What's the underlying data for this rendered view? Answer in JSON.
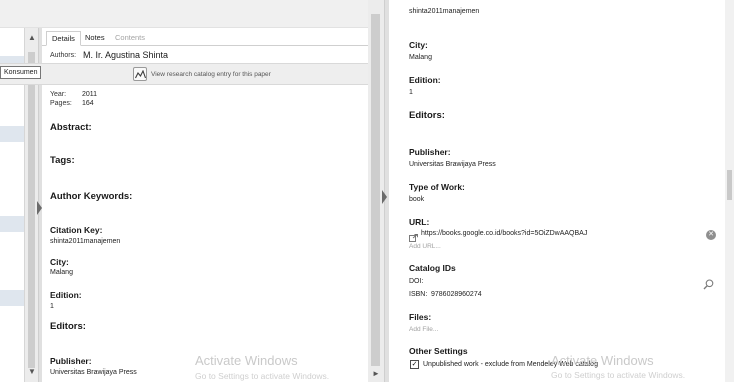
{
  "left": {
    "tabs": [
      {
        "label": "Details",
        "active": true
      },
      {
        "label": "Notes",
        "active": false
      },
      {
        "label": "Contents",
        "active": false
      }
    ],
    "authors_label": "Authors:",
    "authors_value": "M. Ir. Agustina Shinta",
    "tooltip": "Konsumen",
    "catalog_link": "View research catalog entry for this paper",
    "year_label": "Year:",
    "year_value": "2011",
    "pages_label": "Pages:",
    "pages_value": "164",
    "abstract_label": "Abstract:",
    "tags_label": "Tags:",
    "author_keywords_label": "Author Keywords:",
    "citation_key_label": "Citation Key:",
    "citation_key_value": "shinta2011manajemen",
    "city_label": "City:",
    "city_value": "Malang",
    "edition_label": "Edition:",
    "edition_value": "1",
    "editors_label": "Editors:",
    "publisher_label": "Publisher:",
    "publisher_value": "Universitas Brawijaya Press",
    "watermark_title": "Activate Windows",
    "watermark_sub": "Go to Settings to activate Windows."
  },
  "right": {
    "top_value": "shinta2011manajemen",
    "city_label": "City:",
    "city_value": "Malang",
    "edition_label": "Edition:",
    "edition_value": "1",
    "editors_label": "Editors:",
    "publisher_label": "Publisher:",
    "publisher_value": "Universitas Brawijaya Press",
    "type_label": "Type of Work:",
    "type_value": "book",
    "url_label": "URL:",
    "url_value": "https://books.google.co.id/books?id=5OiZDwAAQBAJ",
    "add_url": "Add URL...",
    "catalog_ids_label": "Catalog IDs",
    "doi_label": "DOI:",
    "isbn_label": "ISBN:",
    "isbn_value": "9786028960274",
    "files_label": "Files:",
    "add_file": "Add File...",
    "other_settings_label": "Other Settings",
    "unpublished_label": "Unpublished work - exclude from Mendeley Web catalog",
    "unpublished_checked": true,
    "watermark_title": "Activate Windows",
    "watermark_sub": "Go to Settings to activate Windows."
  },
  "icons": {
    "catalog": "catalog-entry-icon",
    "url": "external-link-icon",
    "clear": "clear-icon",
    "doi_lookup": "search-icon"
  }
}
